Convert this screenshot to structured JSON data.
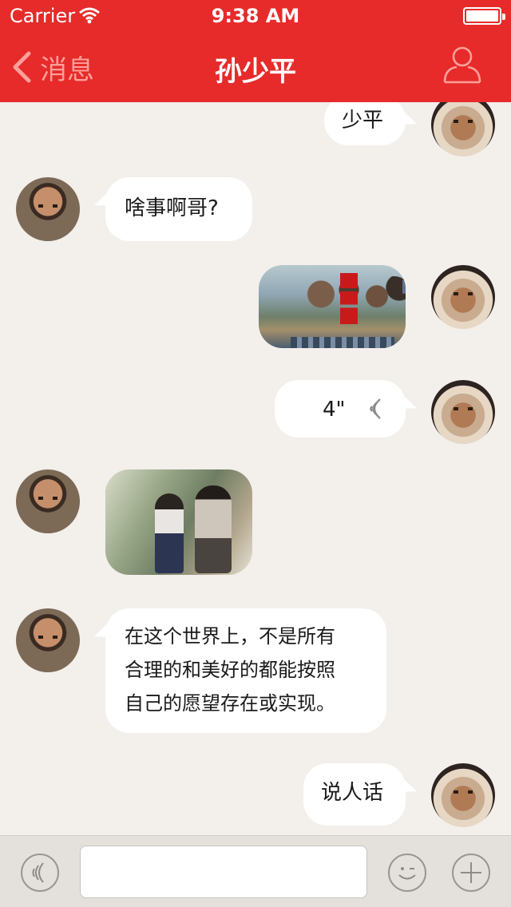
{
  "status_bar": {
    "carrier": "Carrier",
    "time": "9:38 AM",
    "battery_level": 1.0
  },
  "nav": {
    "back_label": "消息",
    "title": "孙少平",
    "profile_icon": "person-icon"
  },
  "colors": {
    "header": "#e62b2a",
    "chat_bg": "#f3efeb",
    "bubble": "#ffffff"
  },
  "messages": [
    {
      "side": "right",
      "type": "text",
      "text": "少平"
    },
    {
      "side": "left",
      "type": "text",
      "text": "啥事啊哥?"
    },
    {
      "side": "right",
      "type": "image",
      "image": "movie-poster"
    },
    {
      "side": "right",
      "type": "voice",
      "duration": "4\""
    },
    {
      "side": "left",
      "type": "image",
      "image": "couple-photo"
    },
    {
      "side": "left",
      "type": "text",
      "lines": [
        "在这个世界上，不是所有",
        "合理的和美好的都能按照",
        "自己的愿望存在或实现。"
      ]
    },
    {
      "side": "right",
      "type": "text",
      "text": "说人话"
    }
  ],
  "input_bar": {
    "placeholder": "",
    "left_icon": "voice-icon",
    "emoji_icon": "emoji-icon",
    "plus_icon": "plus-icon"
  }
}
